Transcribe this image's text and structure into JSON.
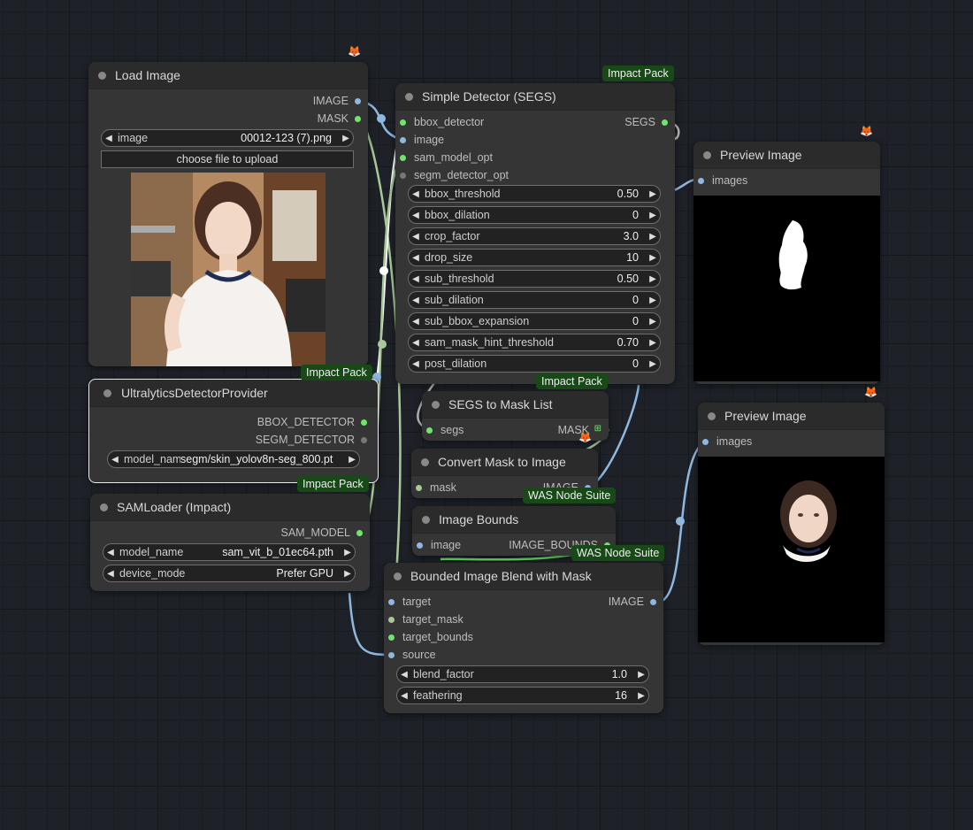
{
  "badges": {
    "impact_pack_1": "Impact Pack",
    "impact_pack_2": "Impact Pack",
    "impact_pack_3": "Impact Pack",
    "impact_pack_4": "Impact Pack",
    "was_1": "WAS Node Suite",
    "was_2": "WAS Node Suite"
  },
  "load_image": {
    "title": "Load Image",
    "outputs": [
      "IMAGE",
      "MASK"
    ],
    "image_label": "image",
    "image_value": "00012-123 (7).png",
    "upload_label": "choose file to upload"
  },
  "ultralytics": {
    "title": "UltralyticsDetectorProvider",
    "outputs": [
      "BBOX_DETECTOR",
      "SEGM_DETECTOR"
    ],
    "model_label": "model_name",
    "model_value": "segm/skin_yolov8n-seg_800.pt"
  },
  "samloader": {
    "title": "SAMLoader (Impact)",
    "output": "SAM_MODEL",
    "widgets": [
      {
        "label": "model_name",
        "value": "sam_vit_b_01ec64.pth"
      },
      {
        "label": "device_mode",
        "value": "Prefer GPU"
      }
    ]
  },
  "simple_detector": {
    "title": "Simple Detector (SEGS)",
    "inputs": [
      "bbox_detector",
      "image",
      "sam_model_opt",
      "segm_detector_opt"
    ],
    "output": "SEGS",
    "widgets": [
      {
        "label": "bbox_threshold",
        "value": "0.50"
      },
      {
        "label": "bbox_dilation",
        "value": "0"
      },
      {
        "label": "crop_factor",
        "value": "3.0"
      },
      {
        "label": "drop_size",
        "value": "10"
      },
      {
        "label": "sub_threshold",
        "value": "0.50"
      },
      {
        "label": "sub_dilation",
        "value": "0"
      },
      {
        "label": "sub_bbox_expansion",
        "value": "0"
      },
      {
        "label": "sam_mask_hint_threshold",
        "value": "0.70"
      },
      {
        "label": "post_dilation",
        "value": "0"
      }
    ]
  },
  "segs_to_mask": {
    "title": "SEGS to Mask List",
    "input": "segs",
    "output": "MASK"
  },
  "convert_mask": {
    "title": "Convert Mask to Image",
    "input": "mask",
    "output": "IMAGE"
  },
  "image_bounds": {
    "title": "Image Bounds",
    "input": "image",
    "output": "IMAGE_BOUNDS"
  },
  "bounded_blend": {
    "title": "Bounded Image Blend with Mask",
    "inputs": [
      "target",
      "target_mask",
      "target_bounds",
      "source"
    ],
    "output": "IMAGE",
    "widgets": [
      {
        "label": "blend_factor",
        "value": "1.0"
      },
      {
        "label": "feathering",
        "value": "16"
      }
    ]
  },
  "preview_1": {
    "title": "Preview Image",
    "input": "images"
  },
  "preview_2": {
    "title": "Preview Image",
    "input": "images"
  },
  "icons": {
    "arrow_left": "◀",
    "arrow_right": "▶",
    "fox": "🦊",
    "grid": "⊞"
  },
  "colors": {
    "badge_bg": "#174a17",
    "slot_green": "#6ee66e",
    "slot_blue": "#8fb8e0",
    "node_bg": "#353535"
  }
}
